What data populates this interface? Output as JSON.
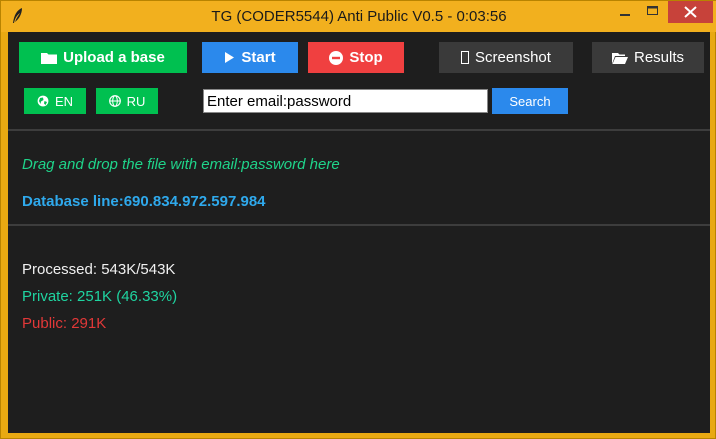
{
  "window": {
    "title": "TG (CODER5544) Anti Public V0.5 - 0:03:56"
  },
  "toolbar": {
    "upload_label": "Upload a base",
    "start_label": "Start",
    "stop_label": "Stop",
    "screenshot_label": "Screenshot",
    "results_label": "Results"
  },
  "language": {
    "en_label": "EN",
    "ru_label": "RU"
  },
  "search": {
    "value": "Enter email:password",
    "button_label": "Search"
  },
  "info": {
    "drop_hint": "Drag and drop the file with email:password here",
    "database_line": "Database line:690.834.972.597.984"
  },
  "stats": {
    "processed": "Processed: 543K/543K",
    "private": "Private: 251K (46.33%)",
    "public": "Public: 291K"
  },
  "colors": {
    "titlebar": "#f2b01e",
    "background": "#1e1e1e",
    "green": "#00c050",
    "blue": "#2b89ec",
    "red": "#f04040",
    "gray": "#3a3a3a"
  },
  "icons": {
    "app": "feather-icon",
    "upload": "folder-icon",
    "start": "play-icon",
    "stop": "stop-icon",
    "screenshot": "square-icon",
    "results": "folder-open-icon",
    "en": "globe-icon",
    "ru": "globe-icon",
    "minimize": "minimize-icon",
    "maximize": "maximize-icon",
    "close": "close-icon"
  }
}
